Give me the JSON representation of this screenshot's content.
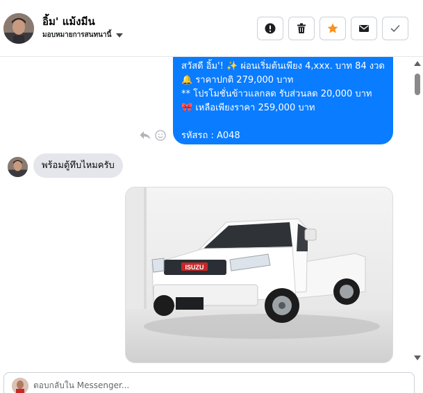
{
  "header": {
    "contact_name": "อิ้ม' แม้งมีน",
    "assign_label": "มอบหมายการสนทนานี้",
    "actions": [
      {
        "icon": "alert-icon",
        "name": "mark-spam-button"
      },
      {
        "icon": "trash-icon",
        "name": "delete-button"
      },
      {
        "icon": "star-icon",
        "name": "star-button"
      },
      {
        "icon": "envelope-icon",
        "name": "mark-unread-button"
      },
      {
        "icon": "check-icon",
        "name": "mark-done-button"
      }
    ]
  },
  "thread": {
    "outgoing_message": "สวัสดี อิ้ม'! ✨  ผ่อนเริ่มต้นเพียง 4,xxx. บาท 84 งวด\n🔔 ราคาปกติ 279,000 บาท\n** โปรโมชั่นข้าวแลกลด รับส่วนลด 20,000 บาท\n🎀  เหลือเพียงราคา 259,000 บาท\n\nรหัสรถ : A048",
    "incoming_message": "พร้อมตู้ทึบไหมครับ",
    "photo_badge": "ISUZU"
  },
  "composer": {
    "placeholder": "ตอบกลับใน Messenger..."
  },
  "colors": {
    "outgoing_bubble": "#0a7cff",
    "incoming_bubble": "#e4e6eb",
    "star": "#f7931e"
  }
}
